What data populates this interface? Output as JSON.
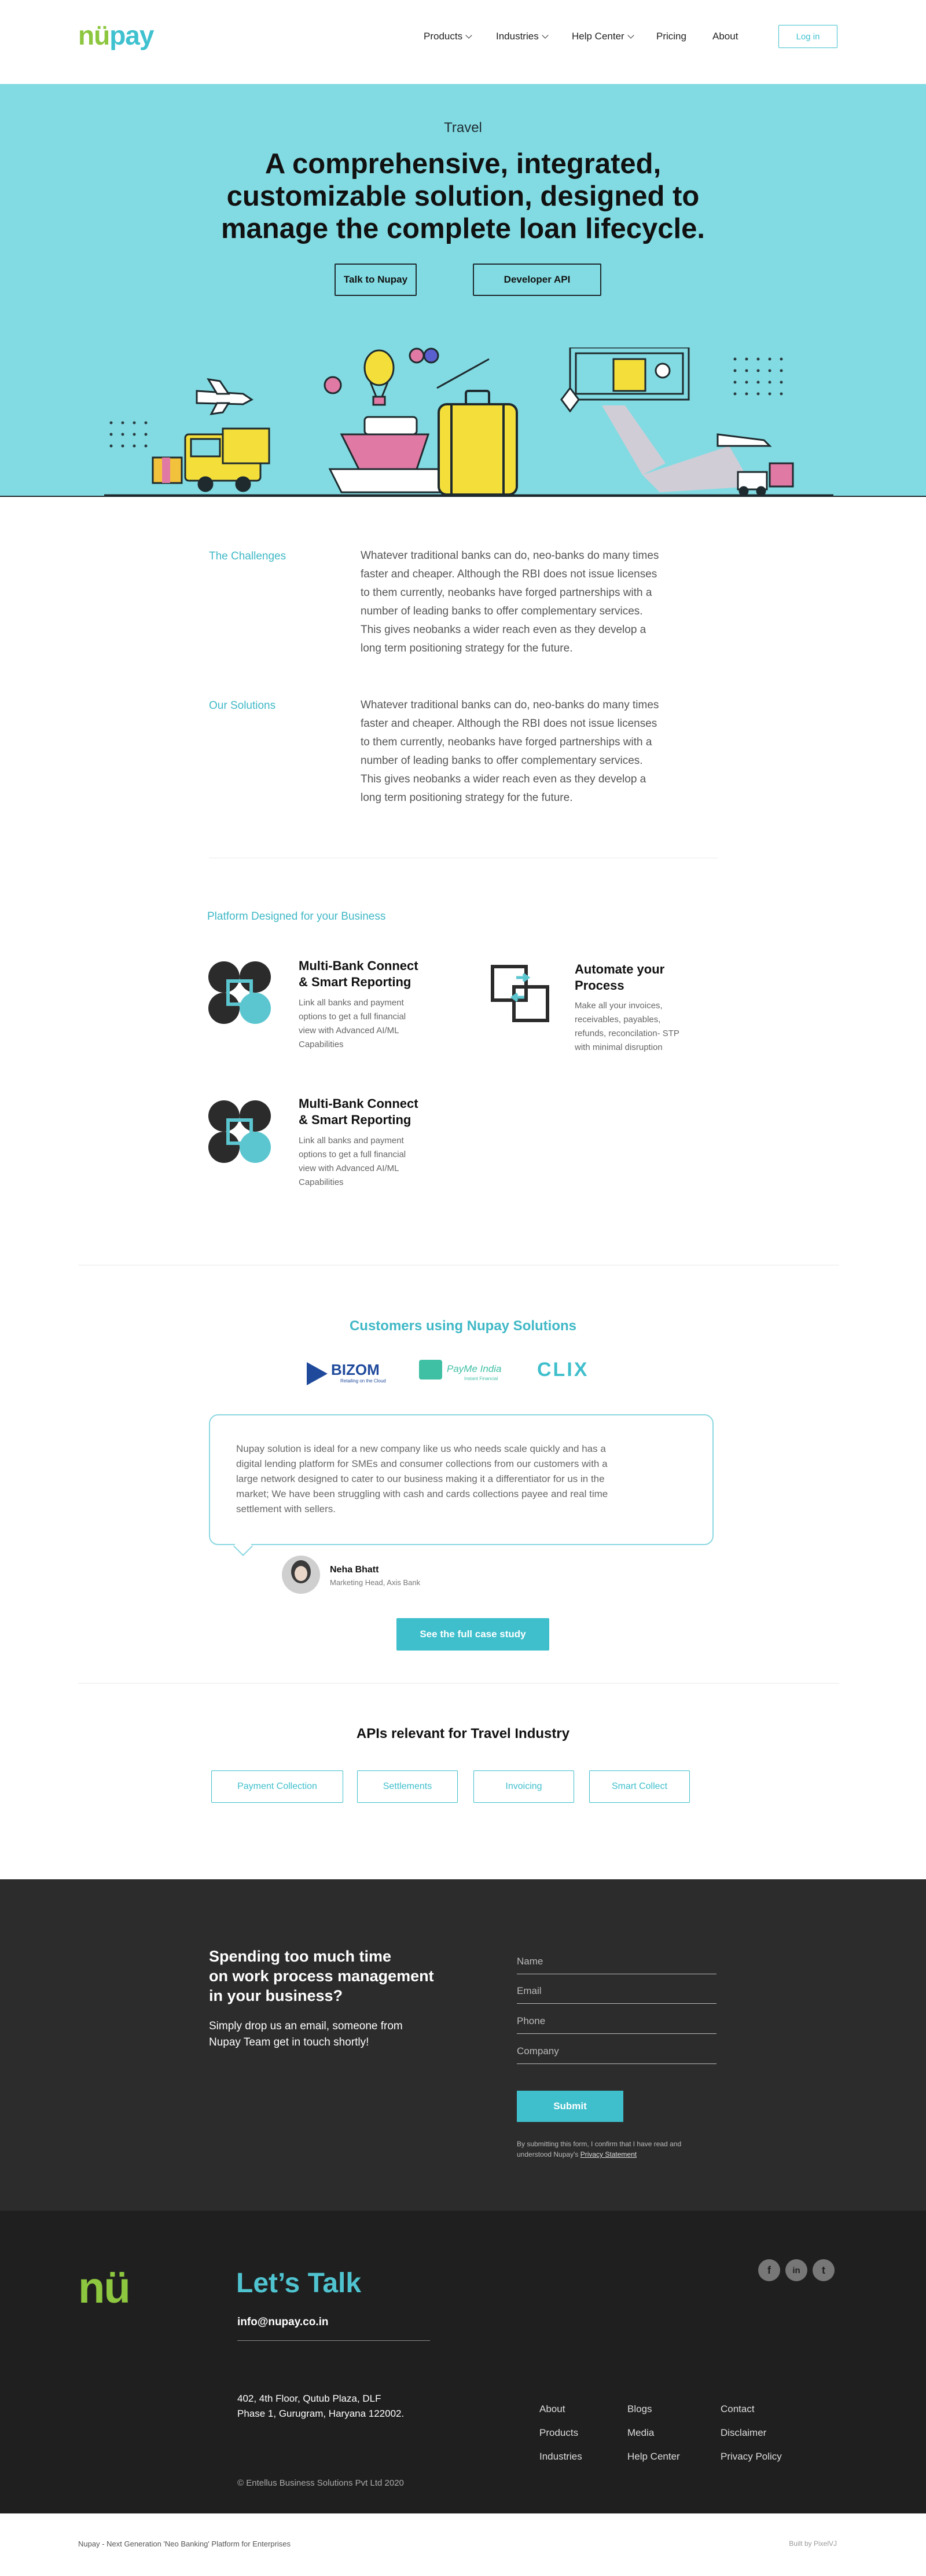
{
  "brand": {
    "logo_nu": "nü",
    "logo_pay": "pay"
  },
  "nav": {
    "products": "Products",
    "industries": "Industries",
    "help_center": "Help Center",
    "pricing": "Pricing",
    "about": "About",
    "login": "Log in"
  },
  "hero": {
    "eyebrow": "Travel",
    "title_1": "A comprehensive, integrated,",
    "title_2": "customizable solution, designed to",
    "title_3": "manage the complete loan lifecycle.",
    "btn_primary": "Talk to Nupay",
    "btn_secondary": "Developer API"
  },
  "challenges": {
    "label": "The Challenges",
    "lines": [
      "Whatever traditional banks can do, neo-banks do many times",
      "faster and cheaper. Although the RBI does not issue licenses",
      "to them currently, neobanks have forged partnerships with a",
      "number of leading banks to offer complementary services.",
      "This gives neobanks a wider reach even as they develop a",
      "long term positioning strategy for the future."
    ]
  },
  "solutions": {
    "label": "Our Solutions",
    "lines": [
      "Whatever traditional banks can do, neo-banks do many times",
      "faster and cheaper. Although the RBI does not issue licenses",
      "to them currently, neobanks have forged partnerships with a",
      "number of leading banks to offer complementary services.",
      "This gives neobanks a wider reach even as they develop a",
      "long term positioning strategy for the future."
    ]
  },
  "platform": {
    "label": "Platform Designed for your Business",
    "features": [
      {
        "title_1": "Multi-Bank Connect",
        "title_2": "& Smart Reporting",
        "desc": [
          "Link all banks and payment",
          "options to get a full financial",
          "view with Advanced AI/ML",
          "Capabilities"
        ]
      },
      {
        "title_1": "Automate your",
        "title_2": "Process",
        "desc": [
          "Make all your invoices,",
          "receivables, payables,",
          "refunds, reconcilation- STP",
          "with minimal disruption"
        ]
      },
      {
        "title_1": "Multi-Bank Connect",
        "title_2": "& Smart Reporting",
        "desc": [
          "Link all banks and payment",
          "options to get a full financial",
          "view with Advanced AI/ML",
          "Capabilities"
        ]
      }
    ]
  },
  "customers": {
    "title": "Customers using Nupay Solutions",
    "logos": {
      "bizom": "BIZOM",
      "bizom_tag": "Retailing on the Cloud",
      "paynear": "PayMe India",
      "paynear_tag": "Instant Financial",
      "clix": "CLIX"
    },
    "quote": [
      "Nupay solution is ideal for a new company like us who needs scale quickly and has a",
      "digital lending platform for SMEs and consumer collections from our customers with a",
      "large network designed to cater to our business making it a differentiator for us in the",
      "market; We have been struggling with cash and cards collections payee and real time",
      "settlement with sellers."
    ],
    "person_name": "Neha Bhatt",
    "person_role": "Marketing Head, Axis Bank",
    "case_btn": "See the full case study"
  },
  "apis": {
    "title": "APIs relevant for Travel Industry",
    "buttons": [
      "Payment Collection",
      "Settlements",
      "Invoicing",
      "Smart Collect"
    ]
  },
  "contact": {
    "heading_1": "Spending too much time",
    "heading_2": "on work process management",
    "heading_3": "in your business?",
    "sub_1": "Simply drop us an email, someone from",
    "sub_2": "Nupay Team get in touch shortly!",
    "fields": [
      "Name",
      "Email",
      "Phone",
      "Company"
    ],
    "submit": "Submit",
    "consent_1": "By submitting this form, I confirm that I have read and",
    "consent_2": "understood Nupay's",
    "privacy_link": "Privacy Statement"
  },
  "footer": {
    "logo": "nü",
    "lets_talk": "Let’s Talk",
    "email": "info@nupay.co.in",
    "address_1": "402, 4th Floor, Qutub Plaza, DLF",
    "address_2": "Phase 1, Gurugram, Haryana 122002.",
    "col1": [
      "About",
      "Products",
      "Industries"
    ],
    "col2": [
      "Blogs",
      "Media",
      "Help Center"
    ],
    "col3": [
      "Contact",
      "Disclaimer",
      "Privacy Policy"
    ],
    "copyright": "© Entellus Business Solutions Pvt Ltd 2020",
    "social": [
      "f",
      "in",
      "t"
    ]
  },
  "bottom": {
    "tagline": "Nupay - Next Generation 'Neo Banking' Platform for Enterprises",
    "built_by": "Built by PixelVJ"
  },
  "colors": {
    "accent": "#3fbfcc",
    "brand_green": "#8dc63f",
    "hero_bg": "#82dbe2",
    "dark_bg": "#2c2c2c",
    "footer_bg": "#1f1f1f"
  }
}
